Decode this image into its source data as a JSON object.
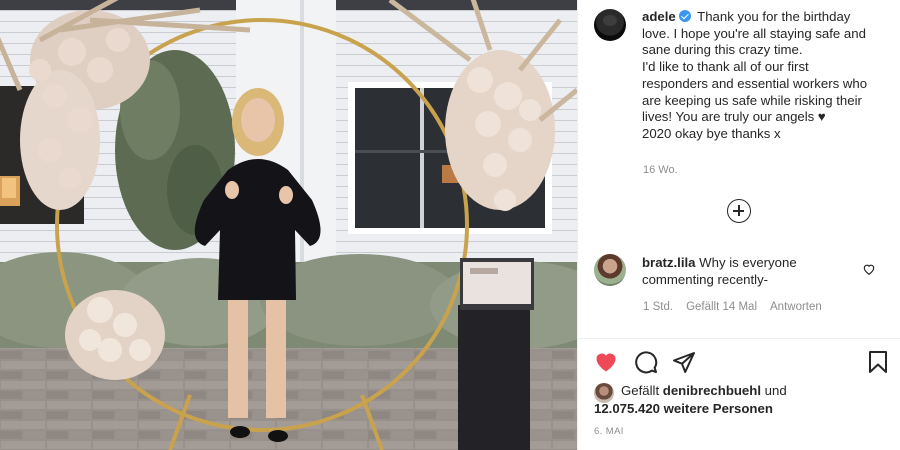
{
  "photo": {
    "description_alt": ""
  },
  "caption": {
    "username": "adele",
    "verified": true,
    "lines": [
      "Thank you for the birthday",
      "love. I hope you're all staying safe and",
      "sane during this crazy time.",
      "I'd like to thank all of our first",
      "responders and essential workers who",
      "are keeping us safe while risking their",
      "lives! You are truly our angels ♥",
      "2020 okay bye thanks x"
    ],
    "time": "16 Wo."
  },
  "comment": {
    "username": "bratz.lila",
    "text": "Why is everyone commenting recently-",
    "time": "1 Std.",
    "likes": "Gefällt 14 Mal",
    "reply": "Antworten"
  },
  "actions": {
    "like_icon": "heart-filled-icon",
    "comment_icon": "comment-icon",
    "share_icon": "paper-plane-icon",
    "save_icon": "bookmark-icon",
    "like_color": "#ed4956"
  },
  "likes": {
    "prefix": "Gefällt",
    "user": "denibrechbuehl",
    "connector": "und",
    "count": "12.075.420 weitere Personen"
  },
  "date": "6. MAI"
}
